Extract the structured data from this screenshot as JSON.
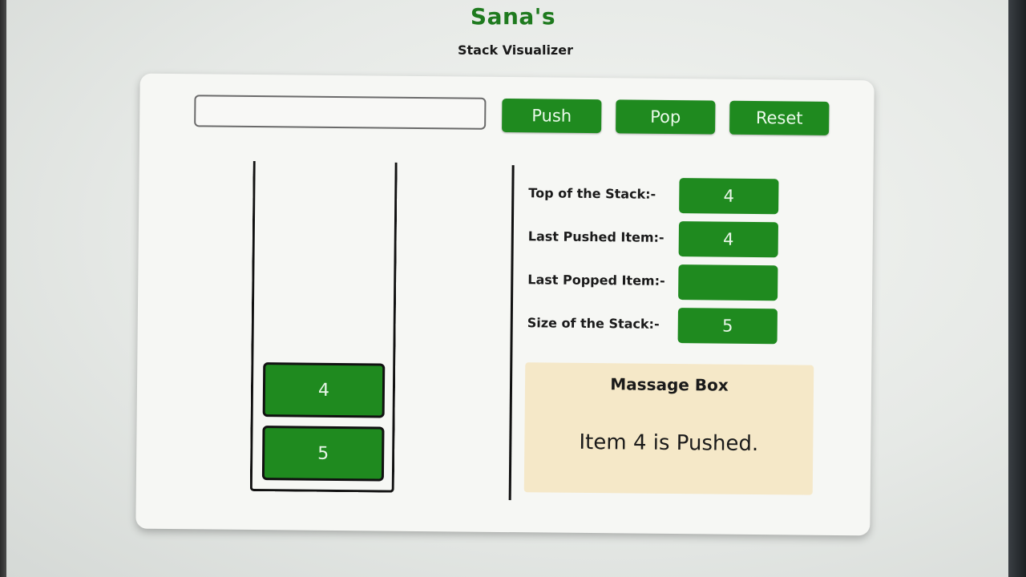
{
  "header": {
    "title": "Sana's",
    "subtitle": "Stack Visualizer"
  },
  "controls": {
    "input_value": "",
    "push_label": "Push",
    "pop_label": "Pop",
    "reset_label": "Reset"
  },
  "stack": {
    "items": [
      "4",
      "5"
    ]
  },
  "info": {
    "top_label": "Top of the Stack:-",
    "top_value": "4",
    "last_pushed_label": "Last Pushed Item:-",
    "last_pushed_value": "4",
    "last_popped_label": "Last Popped Item:-",
    "last_popped_value": "",
    "size_label": "Size of the Stack:-",
    "size_value": "5"
  },
  "message": {
    "title": "Massage Box",
    "text": "Item 4 is Pushed."
  },
  "colors": {
    "accent": "#1f8a1f",
    "title_green": "#1e7a1e",
    "message_bg": "#f5e8c8"
  }
}
